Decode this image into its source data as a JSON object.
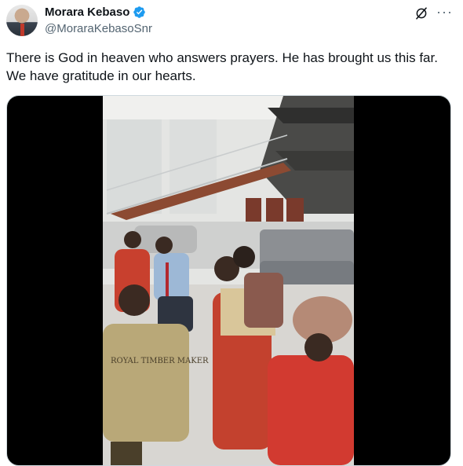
{
  "author": {
    "name": "Morara Kebaso",
    "handle": "@MoraraKebasoSnr",
    "verified": true,
    "verified_color": "#1d9bf0"
  },
  "header_actions": {
    "grok_icon": "grok-slash-icon",
    "more_icon": "more-horizontal-icon"
  },
  "tweet": {
    "text": "There is God in heaven who answers prayers. He has brought us this far. We have gratitude in our hearts."
  },
  "media": {
    "type": "video",
    "overalls_text": "ROYAL TIMBER MAKER"
  },
  "colors": {
    "text": "#0f1419",
    "secondary": "#536471",
    "overall_red": "#c8402e"
  }
}
